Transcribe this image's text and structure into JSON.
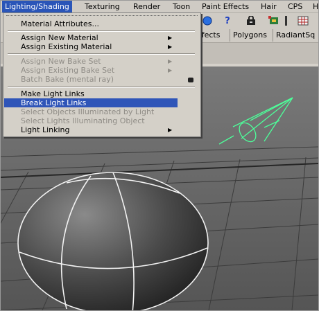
{
  "menubar": {
    "items": [
      {
        "label": "Lighting/Shading",
        "active": true
      },
      {
        "label": "Texturing"
      },
      {
        "label": "Render"
      },
      {
        "label": "Toon"
      },
      {
        "label": "Paint Effects"
      },
      {
        "label": "Hair"
      },
      {
        "label": "CPS"
      },
      {
        "label": "H"
      }
    ]
  },
  "shelf": {
    "tabs": [
      "ffects",
      "Polygons",
      "RadiantSq"
    ]
  },
  "dropdown": {
    "items": [
      {
        "label": "Material Attributes...",
        "disabled": false
      },
      {
        "label": "Assign New Material",
        "disabled": false,
        "submenu": true
      },
      {
        "label": "Assign Existing Material",
        "disabled": false,
        "submenu": true
      },
      {
        "label": "Assign New Bake Set",
        "disabled": true,
        "submenu": true
      },
      {
        "label": "Assign Existing Bake Set",
        "disabled": true,
        "submenu": true
      },
      {
        "label": "Batch Bake (mental ray)",
        "disabled": true,
        "option_box": true
      },
      {
        "label": "Make Light Links",
        "disabled": false
      },
      {
        "label": "Break Light Links",
        "disabled": false,
        "highlighted": true
      },
      {
        "label": "Select Objects Illuminated by Light",
        "disabled": true
      },
      {
        "label": "Select Lights Illuminating Object",
        "disabled": true
      },
      {
        "label": "Light Linking",
        "disabled": false,
        "submenu": true
      }
    ]
  },
  "colors": {
    "menu_bg": "#d4d0c8",
    "highlight": "#2f55b8",
    "viewport_bg": "#6e6e6e",
    "light_gizmo": "#4dff9a"
  },
  "icons": [
    "help-icon",
    "lock-icon",
    "render-icon",
    "hypershade-icon"
  ]
}
